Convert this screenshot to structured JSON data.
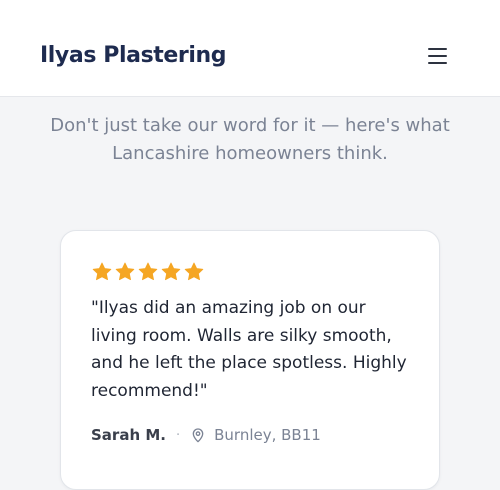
{
  "header": {
    "brand": "Ilyas Plastering",
    "menu_icon": "hamburger-menu-icon"
  },
  "intro": {
    "text": "Don't just take our word for it — here's what Lancashire homeowners think."
  },
  "review": {
    "rating": 5,
    "rating_max": 5,
    "star_icon": "star-icon",
    "star_color": "#f5a623",
    "quote": "\"Ilyas did an amazing job on our living room. Walls are silky smooth, and he left the place spotless. Highly recommend!\"",
    "author": "Sarah M.",
    "separator": "·",
    "location_icon": "map-pin-icon",
    "location": "Burnley, BB11"
  },
  "colors": {
    "brand": "#1e2b4f",
    "muted_text": "#7b8394",
    "page_background": "#f4f5f7"
  }
}
